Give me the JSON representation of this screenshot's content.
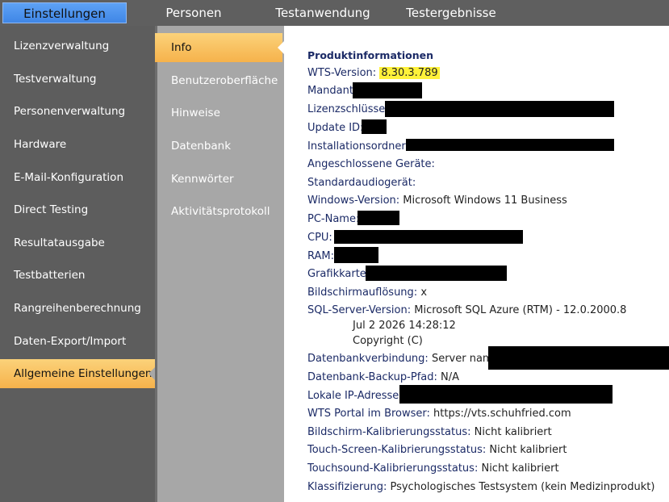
{
  "top_tabs": [
    "Einstellungen",
    "Personen",
    "Testanwendung",
    "Testergebnisse"
  ],
  "left_nav": [
    "Lizenzverwaltung",
    "Testverwaltung",
    "Personenverwaltung",
    "Hardware",
    "E-Mail-Konfiguration",
    "Direct Testing",
    "Resultatausgabe",
    "Testbatterien",
    "Rangreihenberechnung",
    "Daten-Export/Import",
    "Allgemeine Einstellungen"
  ],
  "sub_nav": [
    "Info",
    "Benutzeroberfläche",
    "Hinweise",
    "Datenbank",
    "Kennwörter",
    "Aktivitätsprotokoll"
  ],
  "info": {
    "title": "Produktinformationen",
    "wts_label": "WTS-Version:",
    "wts_value": "8.30.3.789",
    "mandant": "Mandant:",
    "lizenz": "Lizenzschlüssel:",
    "update": "Update ID:",
    "install": "Installationsordner:",
    "geraete": "Angeschlossene Geräte:",
    "audio": "Standardaudiogerät:",
    "windows_label": "Windows-Version:",
    "windows_value": "Microsoft Windows 11 Business",
    "pcname": "PC-Name:",
    "cpu": "CPU:",
    "ram": "RAM:",
    "grafik": "Grafikkarte:",
    "bild_label": "Bildschirmauflösung:",
    "bild_value": "x",
    "sql_label": "SQL-Server-Version:",
    "sql_value": "Microsoft SQL Azure (RTM) - 12.0.2000.8",
    "sql_line2": "Jul  2 2026 14:28:12",
    "sql_line3": "Copyright (C)",
    "dbverb_label": "Datenbankverbindung:",
    "dbverb_value": "Server name:",
    "backup_label": "Datenbank-Backup-Pfad:",
    "backup_value": "N/A",
    "ip_label": "Lokale IP-Adresse:",
    "portal_label": "WTS Portal im Browser:",
    "portal_value": "https://vts.schuhfried.com",
    "bk_label": "Bildschirm-Kalibrierungsstatus:",
    "bk_value": "Nicht kalibriert",
    "tk_label": "Touch-Screen-Kalibrierungsstatus:",
    "tk_value": "Nicht kalibriert",
    "ts_label": "Touchsound-Kalibrierungsstatus:",
    "ts_value": "Nicht kalibriert",
    "klass_label": "Klassifizierung:",
    "klass_value": "Psychologisches Testsystem (kein Medizinprodukt)"
  }
}
